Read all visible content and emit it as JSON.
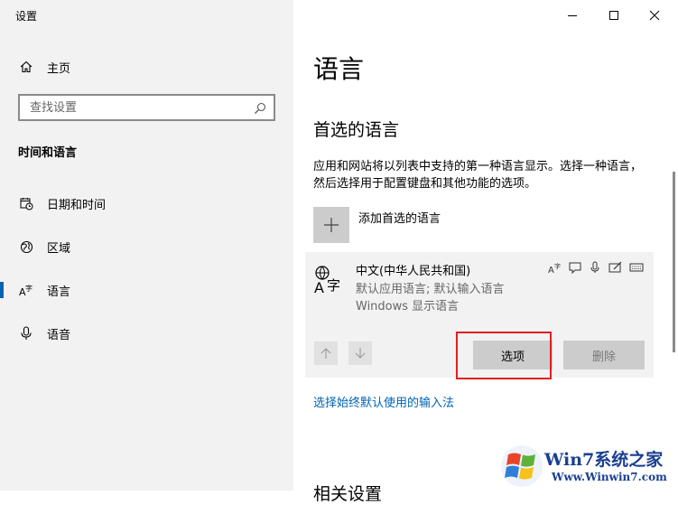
{
  "window": {
    "title": "设置"
  },
  "sidebar": {
    "home_label": "主页",
    "search_placeholder": "查找设置",
    "section_title": "时间和语言",
    "items": [
      {
        "label": "日期和时间",
        "icon": "calendar-clock-icon"
      },
      {
        "label": "区域",
        "icon": "globe-icon"
      },
      {
        "label": "语言",
        "icon": "language-icon",
        "active": true
      },
      {
        "label": "语音",
        "icon": "microphone-icon"
      }
    ]
  },
  "main": {
    "title": "语言",
    "preferred_title": "首选的语言",
    "description": "应用和网站将以列表中支持的第一种语言显示。选择一种语言，然后选择用于配置键盘和其他功能的选项。",
    "add_language_label": "添加首选的语言",
    "language": {
      "name": "中文(中华人民共和国)",
      "line1": "默认应用语言; 默认输入语言",
      "line2": "Windows 显示语言",
      "icon_glyph": "A字",
      "features": [
        "display-language-icon",
        "speech-icon",
        "microphone-icon",
        "handwriting-icon",
        "keyboard-icon"
      ]
    },
    "options_button": "选项",
    "remove_button": "删除",
    "input_method_link": "选择始终默认使用的输入法",
    "related_settings_partial": "相关设置"
  },
  "watermark": {
    "title": "Win7系统之家",
    "url": "Www.Winwin7.com"
  },
  "colors": {
    "accent": "#0063b1",
    "highlight": "#e02020",
    "sidebar_bg": "#f2f2f2"
  }
}
